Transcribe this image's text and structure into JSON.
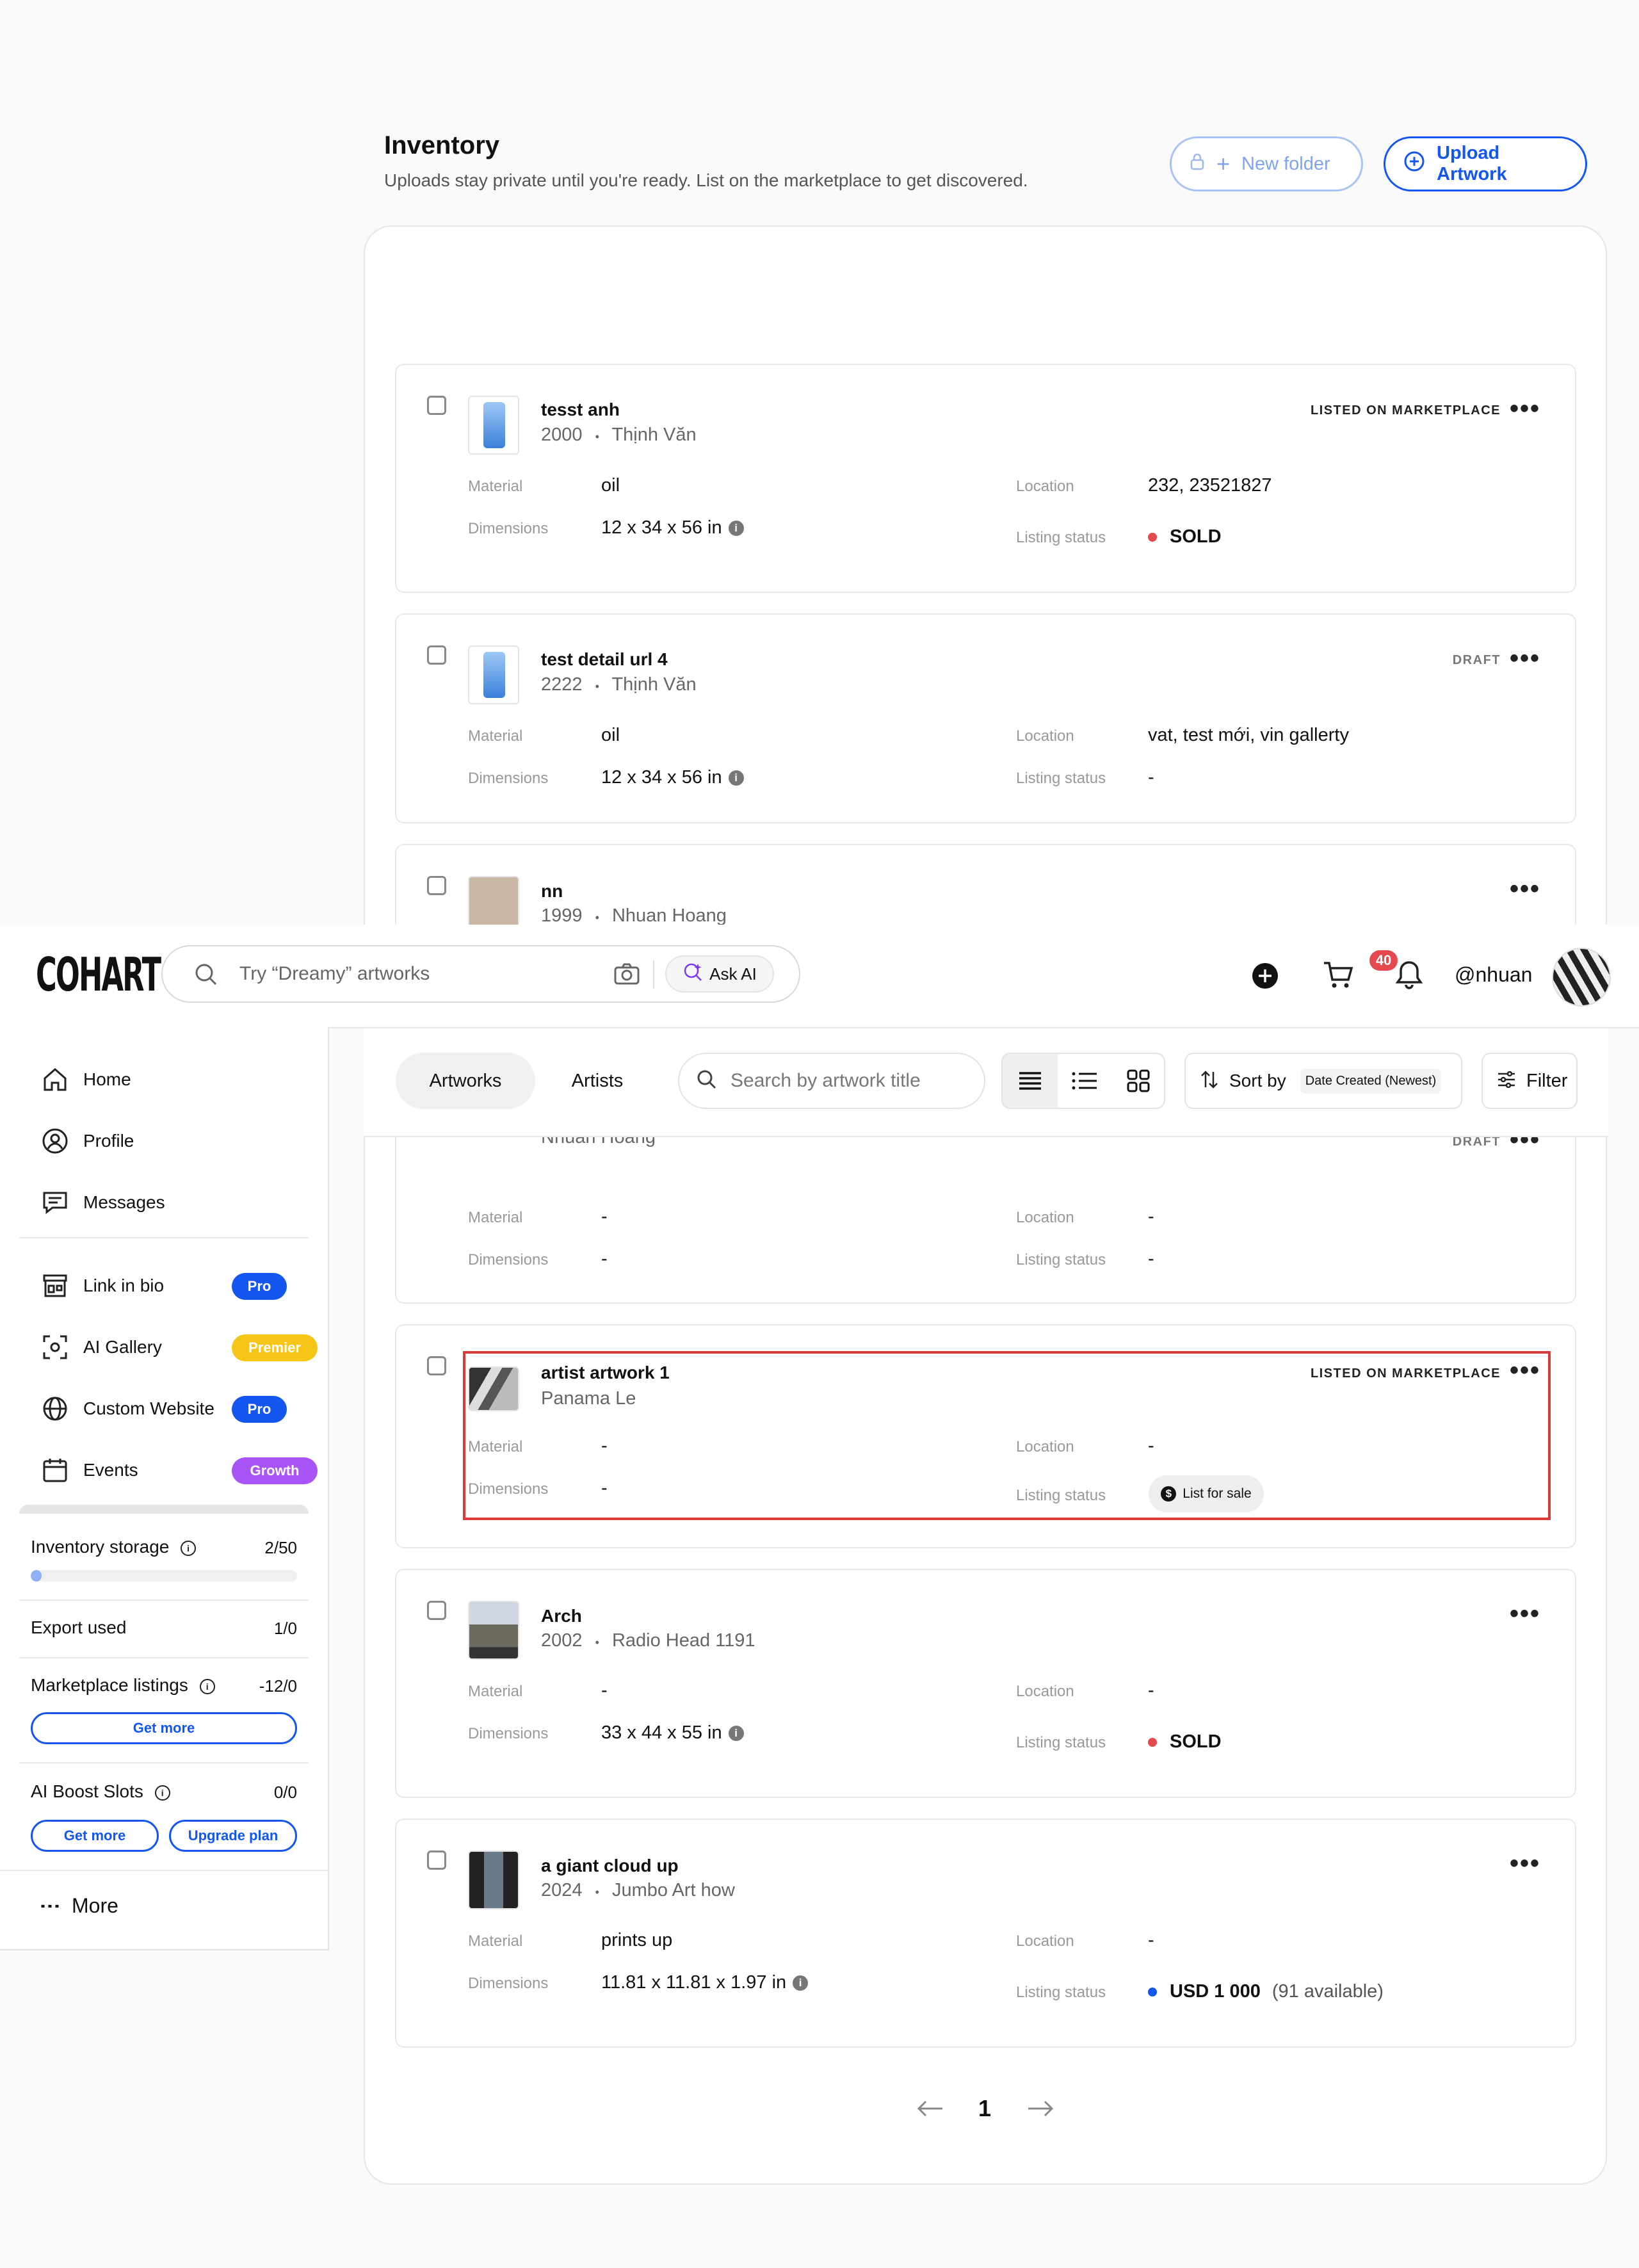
{
  "inventory": {
    "title": "Inventory",
    "subtitle": "Uploads stay private until you're ready. List on the marketplace to get discovered.",
    "new_folder_label": "New folder",
    "upload_label": "Upload Artwork"
  },
  "labels": {
    "material": "Material",
    "dimensions": "Dimensions",
    "location": "Location",
    "listing_status": "Listing status"
  },
  "cards": [
    {
      "title": "tesst anh",
      "year": "2000",
      "artist": "Thịnh Văn",
      "status": "LISTED ON MARKETPLACE",
      "material": "oil",
      "dimensions": "12 x 34 x 56 in",
      "location": "232, 23521827",
      "listing": "SOLD"
    },
    {
      "title": "test detail url 4",
      "year": "2222",
      "artist": "Thịnh Văn",
      "status": "DRAFT",
      "material": "oil",
      "dimensions": "12 x 34 x 56 in",
      "location": "vat, test mới, vin gallerty",
      "listing": "-"
    },
    {
      "title": "nn",
      "year": "1999",
      "artist": "Nhuan Hoang",
      "status": "",
      "artist_repeat": "Nhuan Hoang",
      "status_below": "DRAFT",
      "material": "-",
      "dimensions": "-",
      "location": "-",
      "listing": "-"
    },
    {
      "title": "artist artwork 1",
      "artist": "Panama Le",
      "status": "LISTED ON MARKETPLACE",
      "material": "-",
      "dimensions": "-",
      "location": "-",
      "listing": "List for sale"
    },
    {
      "title": "Arch",
      "year": "2002",
      "artist": "Radio Head 1191",
      "status": "",
      "material": "-",
      "dimensions": "33 x 44 x 55 in",
      "location": "-",
      "listing": "SOLD"
    },
    {
      "title": "a giant cloud up",
      "year": "2024",
      "artist": "Jumbo Art how",
      "status": "",
      "material": "prints up",
      "dimensions": "11.81 x 11.81 x 1.97 in",
      "location": "-",
      "listing": "USD 1 000",
      "listing_extra": "(91 available)"
    }
  ],
  "dot_sep": "•",
  "more_dots": "•••",
  "header": {
    "logo": "COHART",
    "search_placeholder": "Try “Dreamy” artworks",
    "ask_ai": "Ask AI",
    "notif_count": "40",
    "username": "@nhuan"
  },
  "sidebar": {
    "items": [
      {
        "label": "Home"
      },
      {
        "label": "Profile"
      },
      {
        "label": "Messages"
      },
      {
        "label": "Link in bio",
        "badge": "Pro"
      },
      {
        "label": "AI Gallery",
        "badge": "Premier"
      },
      {
        "label": "Custom Website",
        "badge": "Pro"
      },
      {
        "label": "Events",
        "badge": "Growth"
      }
    ],
    "storage_label": "Inventory storage",
    "storage_value": "2/50",
    "storage_fraction": 0.04,
    "export_label": "Export used",
    "export_value": "1/0",
    "marketplace_label": "Marketplace listings",
    "marketplace_value": "-12/0",
    "get_more": "Get more",
    "boost_label": "AI Boost Slots",
    "boost_value": "0/0",
    "upgrade": "Upgrade plan",
    "more": "More"
  },
  "toolbar": {
    "tab_artworks": "Artworks",
    "tab_artists": "Artists",
    "search_placeholder": "Search by artwork title",
    "sort_label": "Sort by",
    "sort_value": "Date Created (Newest)",
    "filter": "Filter"
  },
  "pagination": {
    "current": "1"
  },
  "colors": {
    "accent": "#1456f0",
    "sold": "#e5484d",
    "pro": "#1456f0",
    "premier": "#f5c518",
    "growth": "#a855f7"
  }
}
